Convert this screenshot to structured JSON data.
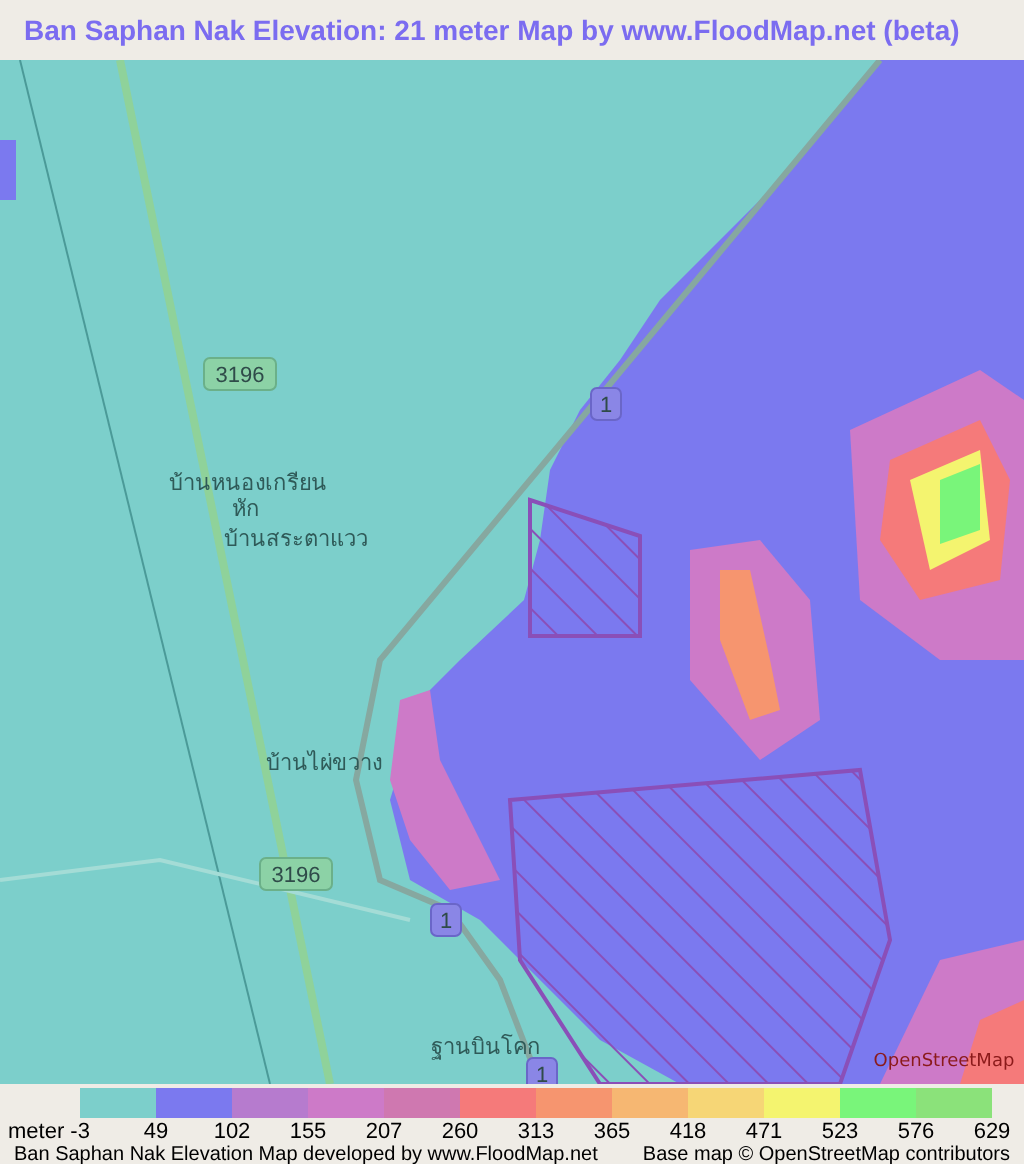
{
  "title": "Ban Saphan Nak Elevation: 21 meter Map by www.FloodMap.net (beta)",
  "map": {
    "labels": [
      {
        "kind": "shield",
        "text": "3196"
      },
      {
        "kind": "shield",
        "text": "1"
      },
      {
        "kind": "place",
        "text": "บ้านหนองเกรียน"
      },
      {
        "kind": "place",
        "text": "หัก"
      },
      {
        "kind": "place",
        "text": "บ้านสระตาแวว"
      },
      {
        "kind": "place",
        "text": "บ้านไผ่ขวาง"
      },
      {
        "kind": "shield",
        "text": "3196"
      },
      {
        "kind": "shield",
        "text": "1"
      },
      {
        "kind": "place",
        "text": "ฐานบินโคก"
      },
      {
        "kind": "shield",
        "text": "1"
      },
      {
        "kind": "logo",
        "text": "OpenStreetMap"
      }
    ]
  },
  "legend": {
    "swatches": [
      {
        "color": "#7ccfcb"
      },
      {
        "color": "#7b79ef"
      },
      {
        "color": "#b67bce"
      },
      {
        "color": "#cd7ac8"
      },
      {
        "color": "#cf78b0"
      },
      {
        "color": "#f57a7a"
      },
      {
        "color": "#f6956f"
      },
      {
        "color": "#f6b772"
      },
      {
        "color": "#f6d676"
      },
      {
        "color": "#f4f46f"
      },
      {
        "color": "#79f57a"
      },
      {
        "color": "#8be27a"
      }
    ],
    "labels": [
      "meter -3",
      "49",
      "102",
      "155",
      "207",
      "260",
      "313",
      "365",
      "418",
      "471",
      "523",
      "576",
      "629"
    ]
  },
  "footer": {
    "left": "Ban Saphan Nak Elevation Map developed by www.FloodMap.net",
    "right": "Base map © OpenStreetMap contributors"
  }
}
